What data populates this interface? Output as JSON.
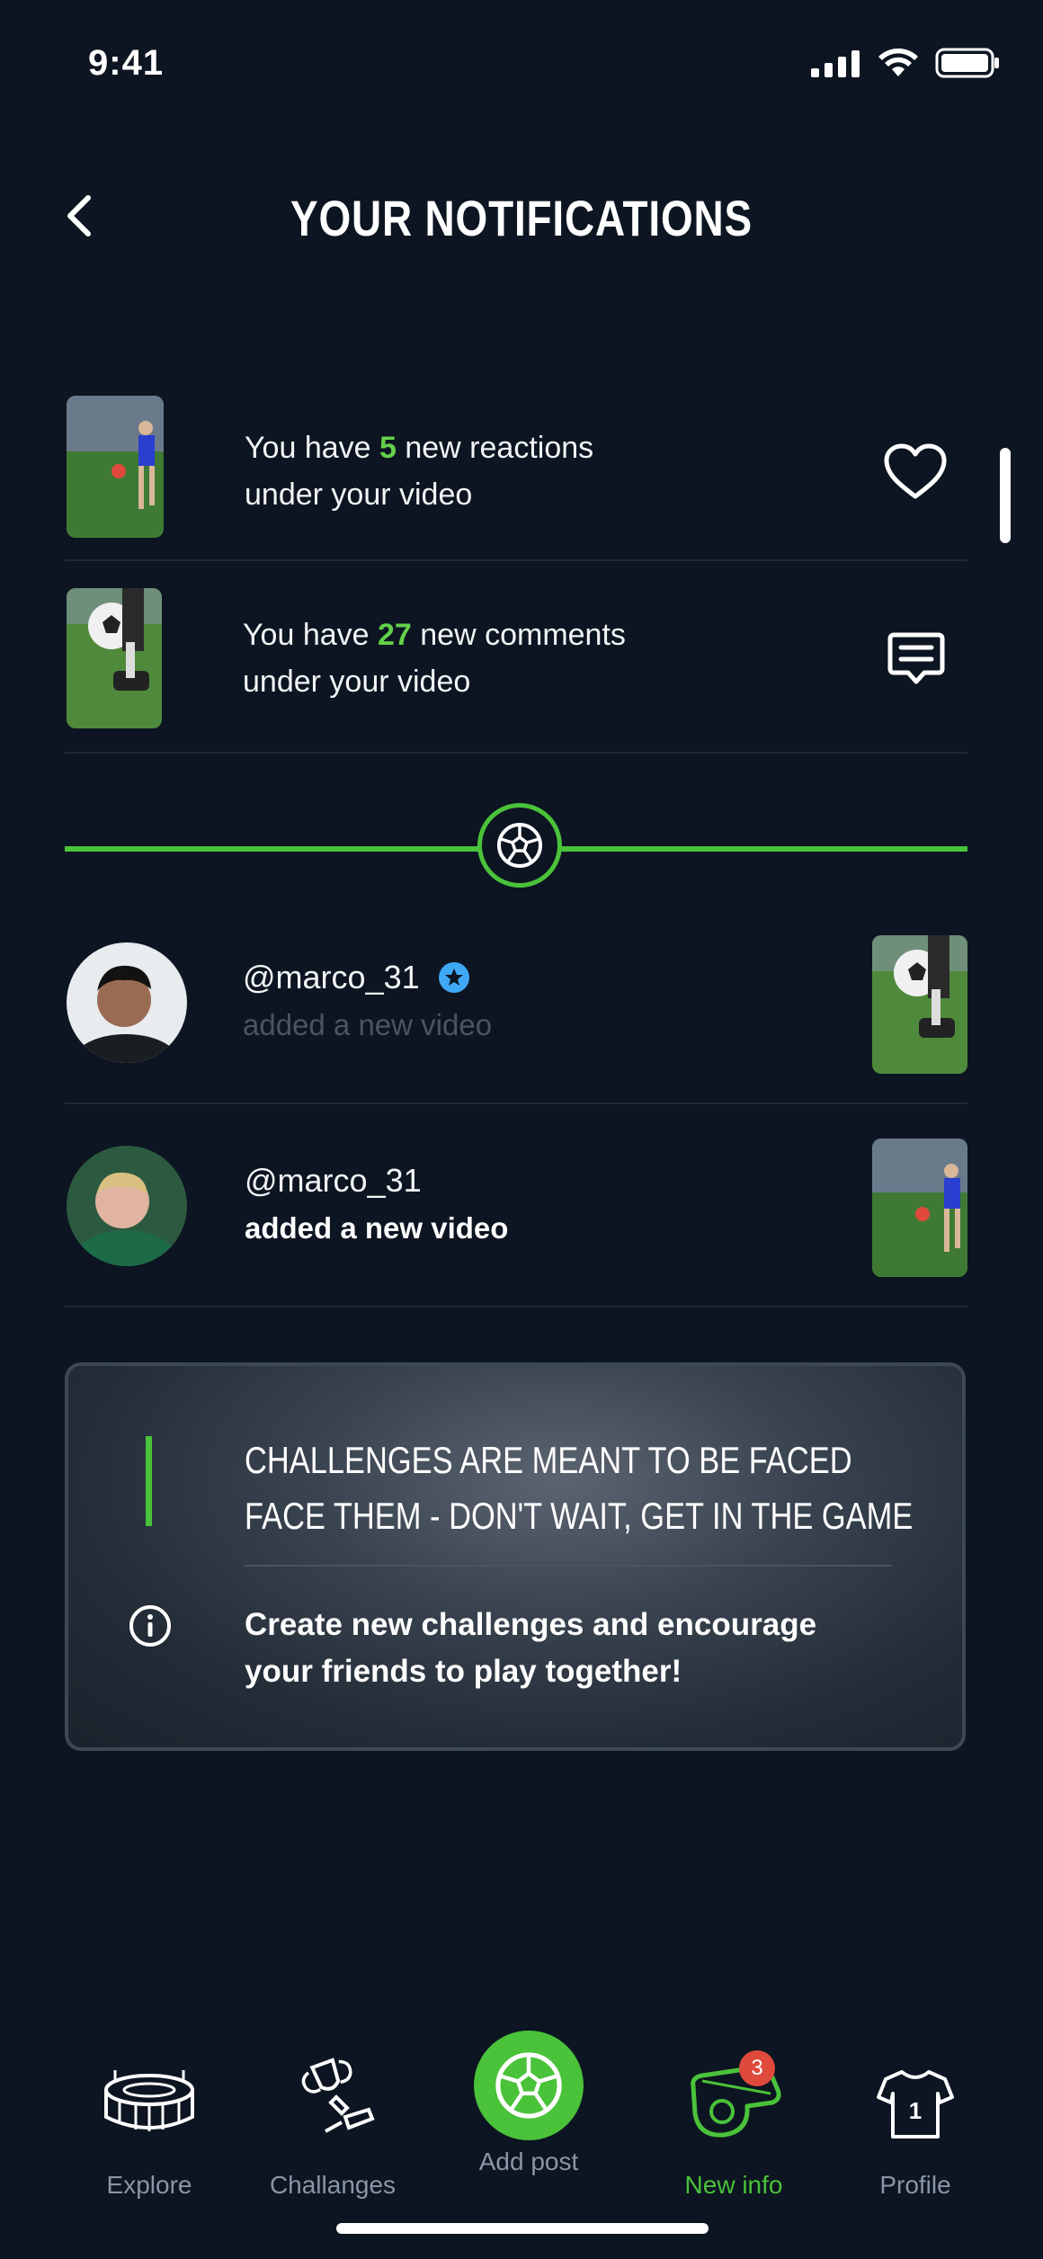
{
  "status": {
    "time": "9:41"
  },
  "header": {
    "title": "YOUR NOTIFICATIONS"
  },
  "notifications": [
    {
      "prefix": "You have ",
      "count": "5",
      "suffix": " new reactions",
      "line2": "under your video",
      "icon": "heart-icon"
    },
    {
      "prefix": "You have ",
      "count": "27",
      "suffix": " new comments",
      "line2": "under your video",
      "icon": "comment-icon"
    }
  ],
  "activity": [
    {
      "user": "@marco_31",
      "text": "added a new video",
      "verified": true
    },
    {
      "user": "@marco_31",
      "text": "added a new video",
      "verified": false
    }
  ],
  "card": {
    "line1": "CHALLENGES ARE MEANT TO BE FACED",
    "line2": "FACE THEM - DON'T WAIT, GET IN THE GAME",
    "info1": "Create new challenges and encourage",
    "info2": "your friends to play together!"
  },
  "nav": [
    {
      "label": "Explore",
      "icon": "stadium-icon"
    },
    {
      "label": "Challanges",
      "icon": "trophy-icon"
    },
    {
      "label": "Add post",
      "icon": "ball-icon"
    },
    {
      "label": "New info",
      "icon": "whistle-icon",
      "badge": "3",
      "active": true
    },
    {
      "label": "Profile",
      "icon": "jersey-icon"
    }
  ],
  "colors": {
    "accent": "#4ac23a",
    "background": "#0c1521",
    "badge": "#e04a3c"
  }
}
